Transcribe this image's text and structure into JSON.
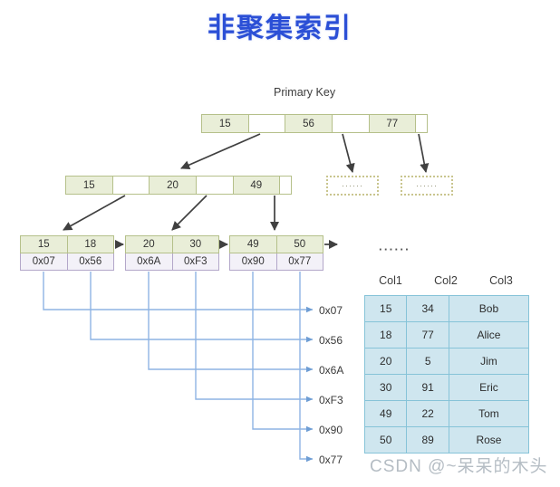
{
  "title": "非聚集索引",
  "labels": {
    "primary_key": "Primary Key",
    "ellipsis": "······",
    "dashed_placeholder": "······"
  },
  "tree": {
    "root": {
      "cells": [
        "15",
        "",
        "56",
        "",
        "77",
        ""
      ]
    },
    "level2": {
      "cells": [
        "15",
        "",
        "20",
        "",
        "49",
        ""
      ]
    },
    "leaves": [
      {
        "keys": [
          "15",
          "18"
        ],
        "pointers": [
          "0x07",
          "0x56"
        ]
      },
      {
        "keys": [
          "20",
          "30"
        ],
        "pointers": [
          "0x6A",
          "0xF3"
        ]
      },
      {
        "keys": [
          "49",
          "50"
        ],
        "pointers": [
          "0x90",
          "0x77"
        ]
      }
    ],
    "placeholders": [
      "······",
      "······"
    ]
  },
  "pointer_targets": [
    {
      "label": "0x07"
    },
    {
      "label": "0x56"
    },
    {
      "label": "0x6A"
    },
    {
      "label": "0xF3"
    },
    {
      "label": "0x90"
    },
    {
      "label": "0x77"
    }
  ],
  "table": {
    "headers": [
      "Col1",
      "Col2",
      "Col3"
    ],
    "rows": [
      [
        "15",
        "34",
        "Bob"
      ],
      [
        "18",
        "77",
        "Alice"
      ],
      [
        "20",
        "5",
        "Jim"
      ],
      [
        "30",
        "91",
        "Eric"
      ],
      [
        "49",
        "22",
        "Tom"
      ],
      [
        "50",
        "89",
        "Rose"
      ]
    ]
  },
  "watermark": "CSDN @~呆呆的木头",
  "colors": {
    "title": "#2b4fd6",
    "node_border": "#b5c08a",
    "node_fill": "#e9eed8",
    "pointer_border": "#b3a7c9",
    "pointer_fill": "#f3f1f8",
    "table_fill": "#cfe6ef",
    "table_border": "#86c3d8",
    "connector": "#8eb4e3",
    "arrow": "#404040",
    "dashed_border": "#c9c58e"
  }
}
